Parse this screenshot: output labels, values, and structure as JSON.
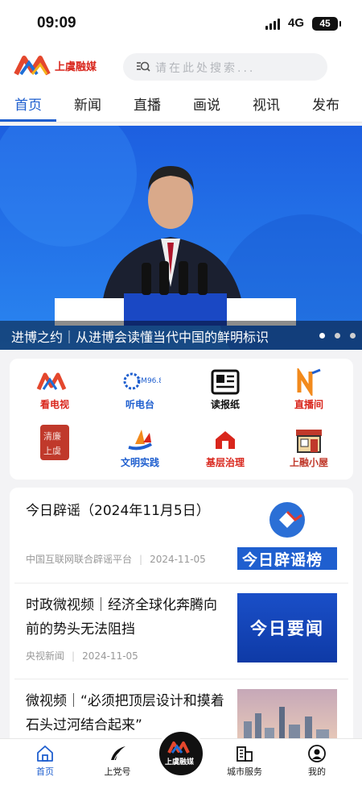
{
  "status": {
    "time": "09:09",
    "network": "4G",
    "battery": "45"
  },
  "header": {
    "logo_text": "上虞融媒",
    "search_placeholder": "请在此处搜索..."
  },
  "tabs": [
    "首页",
    "新闻",
    "直播",
    "画说",
    "视讯",
    "发布"
  ],
  "banner": {
    "caption": "进博之约｜从进博会读懂当代中国的鲜明标识"
  },
  "shortcuts": [
    {
      "label": "看电视",
      "color": "#d9261c"
    },
    {
      "label": "听电台",
      "color": "#1f5fcf"
    },
    {
      "label": "读报纸",
      "color": "#111111"
    },
    {
      "label": "直播间",
      "color": "#d9261c"
    },
    {
      "label": "",
      "color": "#c0392b"
    },
    {
      "label": "文明实践",
      "color": "#1f5fcf"
    },
    {
      "label": "基层治理",
      "color": "#d9261c"
    },
    {
      "label": "上融小屋",
      "color": "#c0392b"
    }
  ],
  "feed": [
    {
      "title": "今日辟谣（2024年11月5日）",
      "source": "中国互联网联合辟谣平台",
      "date": "2024-11-05",
      "thumb_text": "今日辟谣榜"
    },
    {
      "title": "时政微视频｜经济全球化奔腾向前的势头无法阻挡",
      "source": "央视新闻",
      "date": "2024-11-05",
      "thumb_text": "今日要闻"
    },
    {
      "title": "微视频｜“必须把顶层设计和摸着石头过河结合起来”",
      "source": "",
      "date": "",
      "thumb_text": ""
    }
  ],
  "tabbar": {
    "home": "首页",
    "shangdang": "上党号",
    "center": "上虞融媒",
    "city": "城市服务",
    "mine": "我的"
  }
}
